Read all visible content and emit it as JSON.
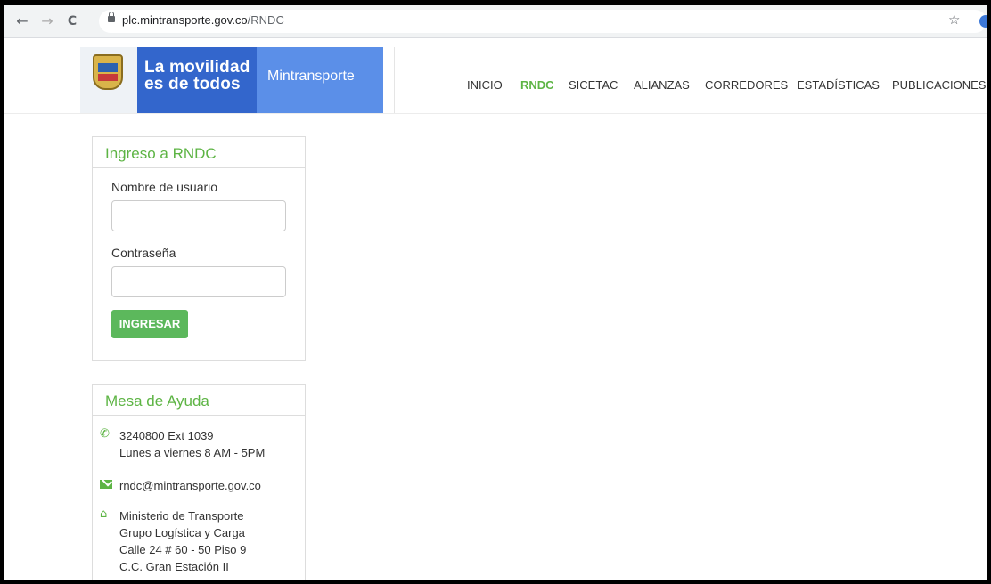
{
  "browser": {
    "back_icon": "←",
    "forward_icon": "→",
    "reload_icon": "C",
    "url_domain": "plc.mintransporte.gov.co",
    "url_path": "/RNDC",
    "star_icon": "☆"
  },
  "header": {
    "brand_line1": "La movilidad",
    "brand_line2": "es de todos",
    "brand_name": "Mintransporte",
    "nav": [
      {
        "label": "INICIO"
      },
      {
        "label": "RNDC"
      },
      {
        "label": "SICETAC"
      },
      {
        "label": "ALIANZAS"
      },
      {
        "label": "CORREDORES"
      },
      {
        "label": "ESTADÍSTICAS"
      },
      {
        "label": "PUBLICACIONES"
      }
    ],
    "active_nav": "RNDC"
  },
  "login": {
    "title": "Ingreso a RNDC",
    "username_label": "Nombre de usuario",
    "username_value": "",
    "password_label": "Contraseña",
    "password_value": "",
    "submit_label": "INGRESAR"
  },
  "help": {
    "title": "Mesa de Ayuda",
    "phone_line1": "3240800  Ext 1039",
    "phone_line2": "Lunes a viernes 8 AM - 5PM",
    "email": "rndc@mintransporte.gov.co",
    "address_line1": "Ministerio de Transporte",
    "address_line2": "Grupo Logística y Carga",
    "address_line3": "Calle 24 # 60 - 50 Piso 9",
    "address_line4": "C.C. Gran Estación II"
  },
  "colors": {
    "accent_green": "#5db444",
    "button_green": "#5cb85c",
    "brand_blue": "#3366cc",
    "brand_light_blue": "#5b8fe8"
  }
}
